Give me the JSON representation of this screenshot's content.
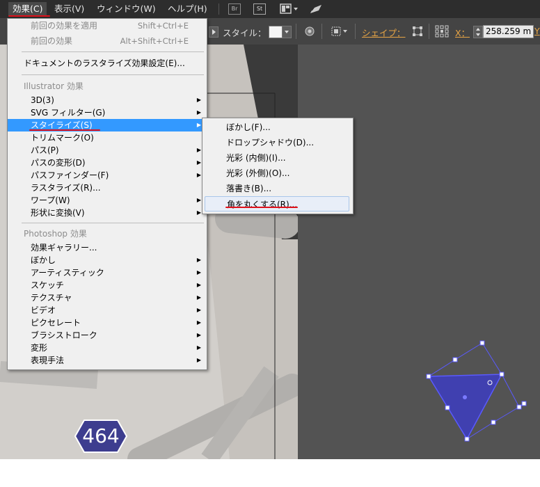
{
  "menubar": {
    "items": [
      "効果(C)",
      "表示(V)",
      "ウィンドウ(W)",
      "ヘルプ(H)"
    ],
    "bridge_label": "Br",
    "stock_label": "St"
  },
  "control_bar": {
    "style_label": "スタイル：",
    "shape_label": "シェイプ：",
    "x_label": "X：",
    "x_value": "258.259 m",
    "y_label": "Y"
  },
  "effect_menu": {
    "reapply": {
      "label": "前回の効果を適用",
      "shortcut": "Shift+Ctrl+E"
    },
    "last": {
      "label": "前回の効果",
      "shortcut": "Alt+Shift+Ctrl+E"
    },
    "raster_settings": "ドキュメントのラスタライズ効果設定(E)...",
    "illustrator_header": "Illustrator 効果",
    "illustrator_items": [
      "3D(3)",
      "SVG フィルター(G)",
      "スタイライズ(S)",
      "トリムマーク(O)",
      "パス(P)",
      "パスの変形(D)",
      "パスファインダー(F)",
      "ラスタライズ(R)...",
      "ワープ(W)",
      "形状に変換(V)"
    ],
    "photoshop_header": "Photoshop 効果",
    "photoshop_items": [
      "効果ギャラリー...",
      "ぼかし",
      "アーティスティック",
      "スケッチ",
      "テクスチャ",
      "ビデオ",
      "ピクセレート",
      "ブラシストローク",
      "変形",
      "表現手法"
    ]
  },
  "stylize_submenu": {
    "items": [
      "ぼかし(F)...",
      "ドロップシャドウ(D)...",
      "光彩 (内側)(I)...",
      "光彩 (外側)(O)...",
      "落書き(B)...",
      "角を丸くする(R)..."
    ]
  },
  "badge": {
    "number": "464"
  },
  "colors": {
    "highlight": "#3399ff",
    "annotation_red": "#e0101a",
    "selection_blue": "#3b3bbf",
    "menu_bg": "#f0f0f0"
  }
}
